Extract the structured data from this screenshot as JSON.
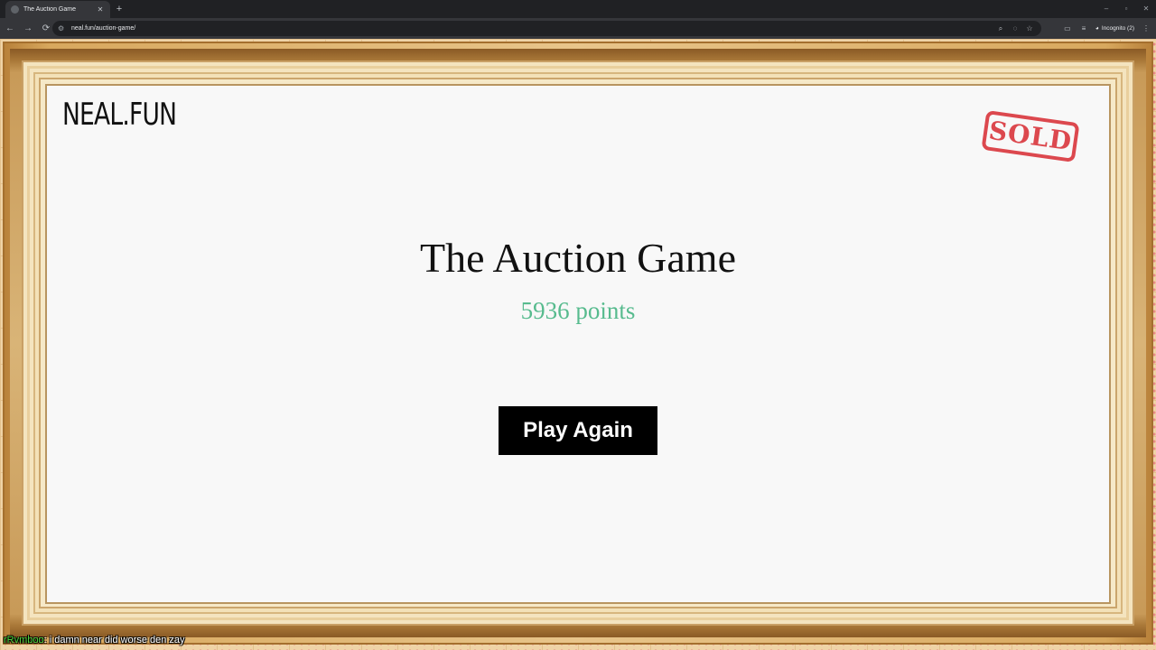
{
  "browser": {
    "tab_title": "The Auction Game",
    "tab_close": "✕",
    "new_tab": "+",
    "url": "neal.fun/auction-game/",
    "profile_label": "Incognito (2)",
    "window_controls": [
      "–",
      "▫",
      "✕"
    ],
    "nav": {
      "back": "←",
      "forward": "→",
      "reload": "⟳"
    },
    "omnibox_icons": [
      "zoom-icon",
      "eye-off-icon",
      "star-icon"
    ],
    "toolbar_icons": [
      "sidebar-icon",
      "media-icon"
    ]
  },
  "page": {
    "logo": "NEAL.FUN",
    "stamp": "SOLD",
    "title": "The Auction Game",
    "score": "5936 points",
    "play_again_label": "Play Again",
    "colors": {
      "score": "#57bb8e",
      "stamp": "#d9363c",
      "button": "#000000"
    }
  },
  "chat_overlay": {
    "user": "rRvmboo",
    "message": ": i damn near did worse den zay"
  }
}
